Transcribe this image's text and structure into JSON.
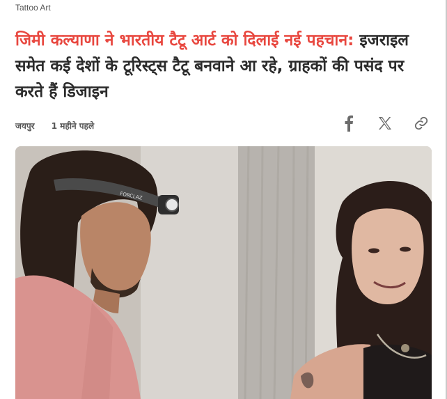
{
  "category": "Tattoo Art",
  "headline": {
    "highlight": "जिमी कल्याणा ने भारतीय टैटू आर्ट को दिलाई नई पहचान:",
    "rest": " इजराइल समेत कई देशों के टूरिस्ट्स टैटू बनवाने आ रहे, ग्राहकों की पसंद पर करते हैं डिजाइन"
  },
  "meta": {
    "location": "जयपुर",
    "time_ago": "1 महीने पहले"
  },
  "share": {
    "icons": [
      "facebook-icon",
      "x-icon",
      "link-icon"
    ]
  },
  "photo": {
    "headlamp_text": "FORCLAZ"
  },
  "colors": {
    "highlight": "#e8473f",
    "text": "#2b2b2b",
    "meta": "#555555",
    "icon": "#6b6b6b"
  }
}
